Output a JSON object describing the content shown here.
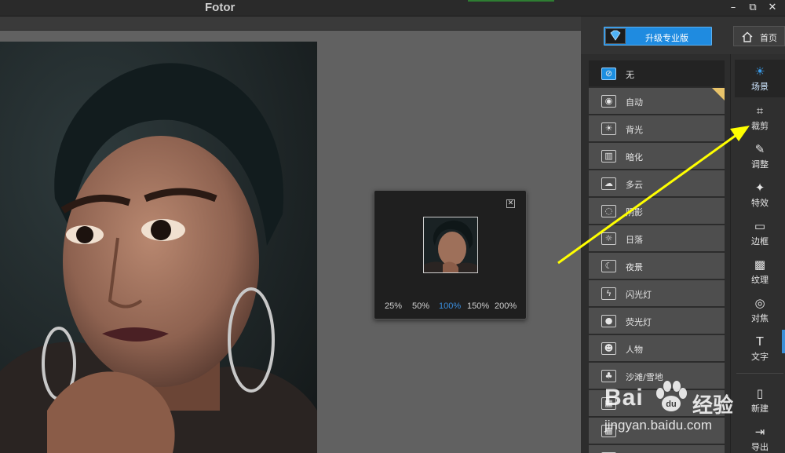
{
  "window": {
    "title": "Fotor",
    "controls": {
      "minimize": "–",
      "restore": "⧉",
      "close": "✕"
    }
  },
  "header": {
    "upgrade_label": "升级专业版",
    "upgrade_icon": "diamond-icon",
    "home_label": "首页",
    "home_icon": "home-icon"
  },
  "navigator": {
    "close_glyph": "✕",
    "zoom_options": [
      "25%",
      "50%",
      "100%",
      "150%",
      "200%"
    ],
    "active_zoom": "100%"
  },
  "scenes": [
    {
      "label": "无",
      "icon": "no-symbol-icon",
      "glyph": "⊘",
      "selected": true
    },
    {
      "label": "自动",
      "icon": "camera-icon",
      "glyph": "◉",
      "premium": true
    },
    {
      "label": "背光",
      "icon": "backlight-icon",
      "glyph": "☀"
    },
    {
      "label": "暗化",
      "icon": "dark-icon",
      "glyph": "▥"
    },
    {
      "label": "多云",
      "icon": "cloud-icon",
      "glyph": "☁"
    },
    {
      "label": "阴影",
      "icon": "shadow-icon",
      "glyph": "◌"
    },
    {
      "label": "日落",
      "icon": "sunset-icon",
      "glyph": "☼"
    },
    {
      "label": "夜景",
      "icon": "moon-icon",
      "glyph": "☾"
    },
    {
      "label": "闪光灯",
      "icon": "flash-icon",
      "glyph": "ϟ"
    },
    {
      "label": "荧光灯",
      "icon": "bulb-icon",
      "glyph": "●"
    },
    {
      "label": "人物",
      "icon": "person-icon",
      "glyph": "☻"
    },
    {
      "label": "沙滩/雪地",
      "icon": "beach-icon",
      "glyph": "♣"
    },
    {
      "label": "",
      "icon": "scene-icon",
      "glyph": "▦"
    },
    {
      "label": "",
      "icon": "scene-icon",
      "glyph": "▦"
    },
    {
      "label": "",
      "icon": "scene-icon",
      "glyph": "▦"
    }
  ],
  "tools": [
    {
      "label": "场景",
      "icon": "scene-sun-icon",
      "glyph": "☀",
      "active": true
    },
    {
      "label": "裁剪",
      "icon": "crop-icon",
      "glyph": "⌗"
    },
    {
      "label": "调整",
      "icon": "pencil-icon",
      "glyph": "✎"
    },
    {
      "label": "特效",
      "icon": "sparkle-icon",
      "glyph": "✦"
    },
    {
      "label": "边框",
      "icon": "frame-icon",
      "glyph": "▭"
    },
    {
      "label": "纹理",
      "icon": "texture-icon",
      "glyph": "▩"
    },
    {
      "label": "对焦",
      "icon": "focus-icon",
      "glyph": "◎"
    },
    {
      "label": "文字",
      "icon": "text-icon",
      "glyph": "T"
    },
    {
      "label": "新建",
      "icon": "new-file-icon",
      "glyph": "▯"
    },
    {
      "label": "导出",
      "icon": "export-icon",
      "glyph": "⇥"
    }
  ],
  "watermark": {
    "brand": "Bai",
    "brand_suffix": "经验",
    "url": "jingyan.baidu.com"
  },
  "colors": {
    "accent": "#1f8be0",
    "arrow": "#ffff00",
    "premium": "#e8c36a"
  }
}
